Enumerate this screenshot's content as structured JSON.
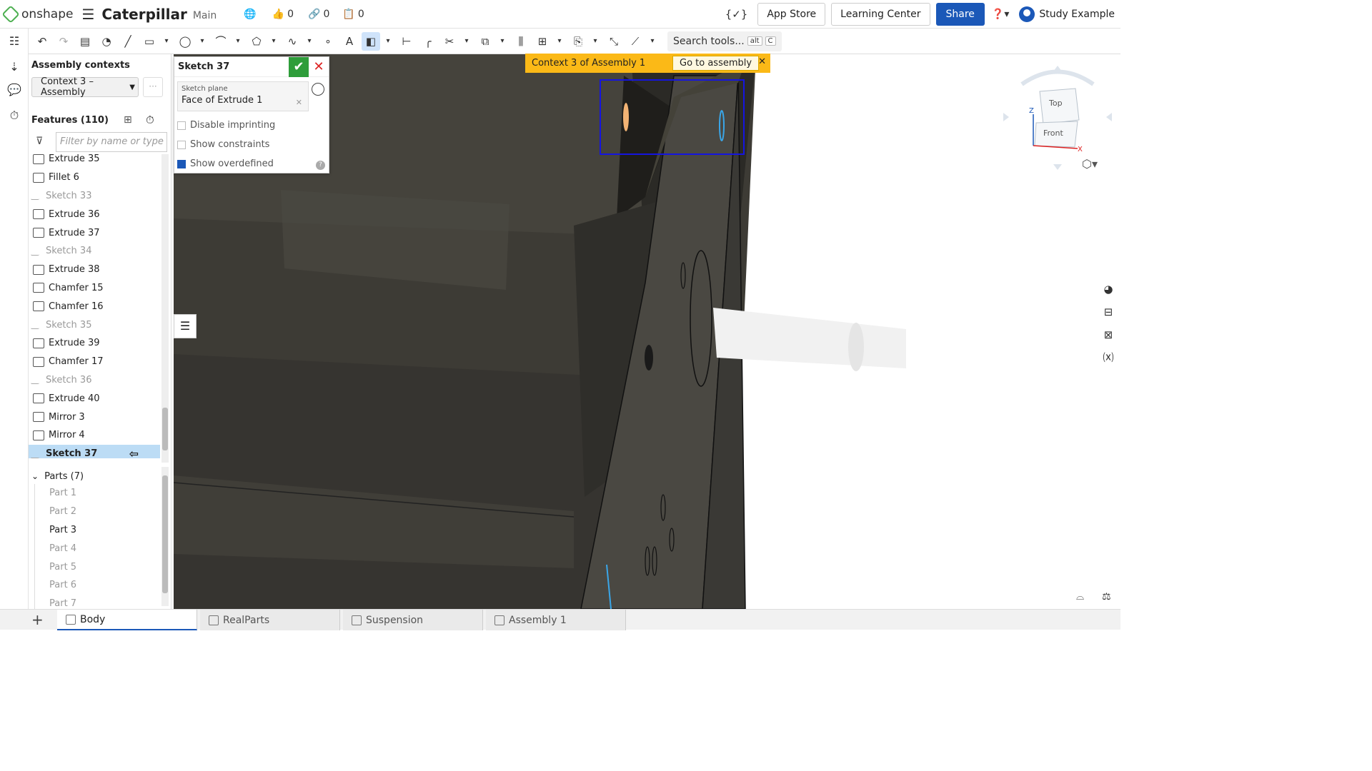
{
  "header": {
    "app_name": "onshape",
    "doc_title": "Caterpillar",
    "branch": "Main",
    "likes": "0",
    "links": "0",
    "copies": "0",
    "app_store": "App Store",
    "learning_center": "Learning Center",
    "share": "Share",
    "user": "Study Example"
  },
  "toolbar": {
    "search_label": "Search tools...",
    "kbd_alt": "alt",
    "kbd_c": "C"
  },
  "panel": {
    "assembly_contexts": "Assembly contexts",
    "context_select": "Context 3 – Assembly",
    "more": "···",
    "features_title": "Features (110)",
    "filter_placeholder": "Filter by name or type",
    "features": [
      {
        "label": "Extrude 35",
        "type": "feature"
      },
      {
        "label": "Fillet 6",
        "type": "feature"
      },
      {
        "label": "Sketch 33",
        "type": "sketch"
      },
      {
        "label": "Extrude 36",
        "type": "feature"
      },
      {
        "label": "Extrude 37",
        "type": "feature"
      },
      {
        "label": "Sketch 34",
        "type": "sketch"
      },
      {
        "label": "Extrude 38",
        "type": "feature"
      },
      {
        "label": "Chamfer 15",
        "type": "feature"
      },
      {
        "label": "Chamfer 16",
        "type": "feature"
      },
      {
        "label": "Sketch 35",
        "type": "sketch"
      },
      {
        "label": "Extrude 39",
        "type": "feature"
      },
      {
        "label": "Chamfer 17",
        "type": "feature"
      },
      {
        "label": "Sketch 36",
        "type": "sketch"
      },
      {
        "label": "Extrude 40",
        "type": "feature"
      },
      {
        "label": "Mirror 3",
        "type": "feature"
      },
      {
        "label": "Mirror 4",
        "type": "feature"
      },
      {
        "label": "Sketch 37",
        "type": "selected"
      }
    ],
    "parts_title": "Parts (7)",
    "parts": [
      "Part 1",
      "Part 2",
      "Part 3",
      "Part 4",
      "Part 5",
      "Part 6",
      "Part 7"
    ]
  },
  "sketch_panel": {
    "title": "Sketch 37",
    "plane_label": "Sketch plane",
    "plane_value": "Face of Extrude 1",
    "disable_imprinting": "Disable imprinting",
    "show_constraints": "Show constraints",
    "show_overdefined": "Show overdefined",
    "show_overdefined_checked": true
  },
  "banner": {
    "text": "Context 3 of Assembly 1",
    "goto": "Go to assembly"
  },
  "viewcube": {
    "top": "Top",
    "front": "Front",
    "axis_z": "Z",
    "axis_x": "X"
  },
  "tabs": [
    "Body",
    "RealParts",
    "Suspension",
    "Assembly 1"
  ],
  "colors": {
    "accent": "#1b58b8",
    "banner": "#fbb917",
    "confirm": "#2e9d3a",
    "selection": "#bcdcf5"
  }
}
